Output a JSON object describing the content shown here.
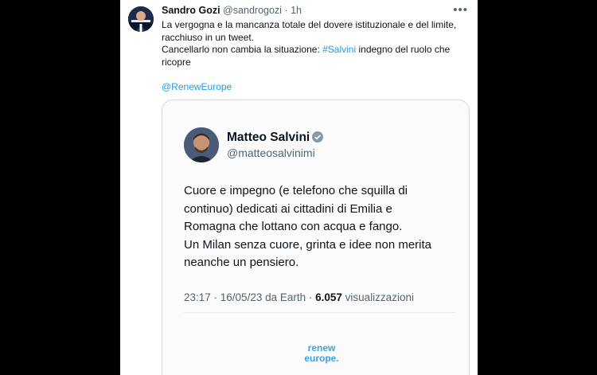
{
  "tweet": {
    "author_name": "Sandro Gozi",
    "author_handle": "@sandrogozi",
    "separator": "·",
    "time": "1h",
    "more_icon": "more-icon",
    "text": {
      "line1": "La vergogna e la mancanza totale del dovere istituzionale e del limite,",
      "line2": "racchiuso in un tweet.",
      "line3_before": "Cancellarlo non cambia la situazione: ",
      "hashtag": "#Salvini",
      "line3_after": " indegno del ruolo che",
      "line4": "ricopre",
      "mention": "@RenewEurope"
    }
  },
  "embedded": {
    "author_name": "Matteo Salvini",
    "author_handle": "@matteosalvinimi",
    "verified_icon": "verified-badge-icon",
    "text_lines": [
      "Cuore e impegno (e telefono che squilla di",
      "continuo) dedicati ai cittadini di Emilia e",
      "Romagna che lottano con acqua e fango.",
      "Un Milan senza cuore, grinta e idee non merita",
      "neanche un pensiero."
    ],
    "meta_timestamp": "23:17 · 16/05/23 da Earth · ",
    "views_count": "6.057",
    "views_label": " visualizzazioni",
    "watermark_line1": "renew",
    "watermark_line2": "europe."
  },
  "colors": {
    "background": "#000000",
    "card": "#ffffff",
    "link": "#1d9bf0",
    "watermark": "#3aa0e8"
  }
}
